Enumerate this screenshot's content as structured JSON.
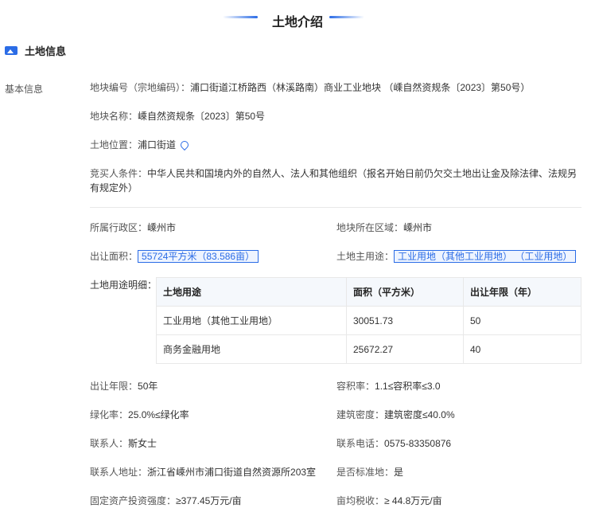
{
  "title": "土地介绍",
  "section": {
    "label": "土地信息",
    "icon": "image-icon"
  },
  "side_label": "基本信息",
  "rows": {
    "code": {
      "k": "地块编号（宗地编码）：",
      "v": "浦口街道江桥路西（林溪路南）商业工业地块 （嵊自然资规条〔2023〕第50号）"
    },
    "name": {
      "k": "地块名称：",
      "v": "嵊自然资规条〔2023〕第50号"
    },
    "location": {
      "k": "土地位置：",
      "v": "浦口街道",
      "icon": "location-pin-icon"
    },
    "bidder": {
      "k": "竞买人条件：",
      "v1": "中华人民共和国境内外的自然人、法人和其他组织（报名开始日前仍欠交土地出让金及除法律、法规另",
      "v2": "有规定外）"
    }
  },
  "fields": {
    "district": {
      "k": "所属行政区：",
      "v": "嵊州市"
    },
    "area_region": {
      "k": "地块所在区域：",
      "v": "嵊州市"
    },
    "area": {
      "k": "出让面积：",
      "v": "55724平方米（83.586亩）"
    },
    "main_use": {
      "k": "土地主用途：",
      "v": "工业用地（其他工业用地） （工业用地）"
    },
    "use_detail": {
      "k": "土地用途明细："
    },
    "years": {
      "k": "出让年限：",
      "v": "50年"
    },
    "far": {
      "k": "容积率：",
      "v": "1.1≤容积率≤3.0"
    },
    "green": {
      "k": "绿化率：",
      "v": "25.0%≤绿化率"
    },
    "density": {
      "k": "建筑密度：",
      "v": "建筑密度≤40.0%"
    },
    "contact": {
      "k": "联系人：",
      "v": "斯女士"
    },
    "phone": {
      "k": "联系电话：",
      "v": "0575-83350876"
    },
    "address": {
      "k": "联系人地址：",
      "v": "浙江省嵊州市浦口街道自然资源所203室"
    },
    "standard": {
      "k": "是否标准地：",
      "v": "是"
    },
    "invest": {
      "k": "固定资产投资强度：",
      "v": "≥377.45万元/亩"
    },
    "tax": {
      "k": "亩均税收：",
      "v": "≥ 44.8万元/亩"
    }
  },
  "table": {
    "headers": [
      "土地用途",
      "面积（平方米）",
      "出让年限（年）"
    ],
    "rows": [
      [
        "工业用地（其他工业用地）",
        "30051.73",
        "50"
      ],
      [
        "商务金融用地",
        "25672.27",
        "40"
      ]
    ]
  },
  "colors": {
    "accent": "#2b6ce6"
  }
}
